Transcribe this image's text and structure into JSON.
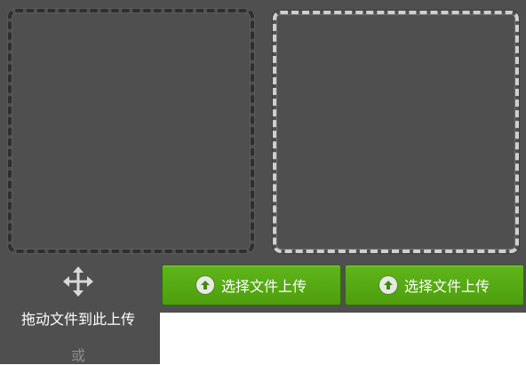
{
  "uploader": {
    "drag_hint": "拖动文件到此上传",
    "or_text": "或",
    "buttons": [
      {
        "label": "选择文件上传",
        "icon": "upload-arrow-icon"
      },
      {
        "label": "选择文件上传",
        "icon": "upload-arrow-icon"
      }
    ],
    "colors": {
      "panel": "#4f4f4f",
      "button_green": "#52a512",
      "dark_dash": "#2e2e2e",
      "light_dash": "#cfcfcf"
    }
  }
}
